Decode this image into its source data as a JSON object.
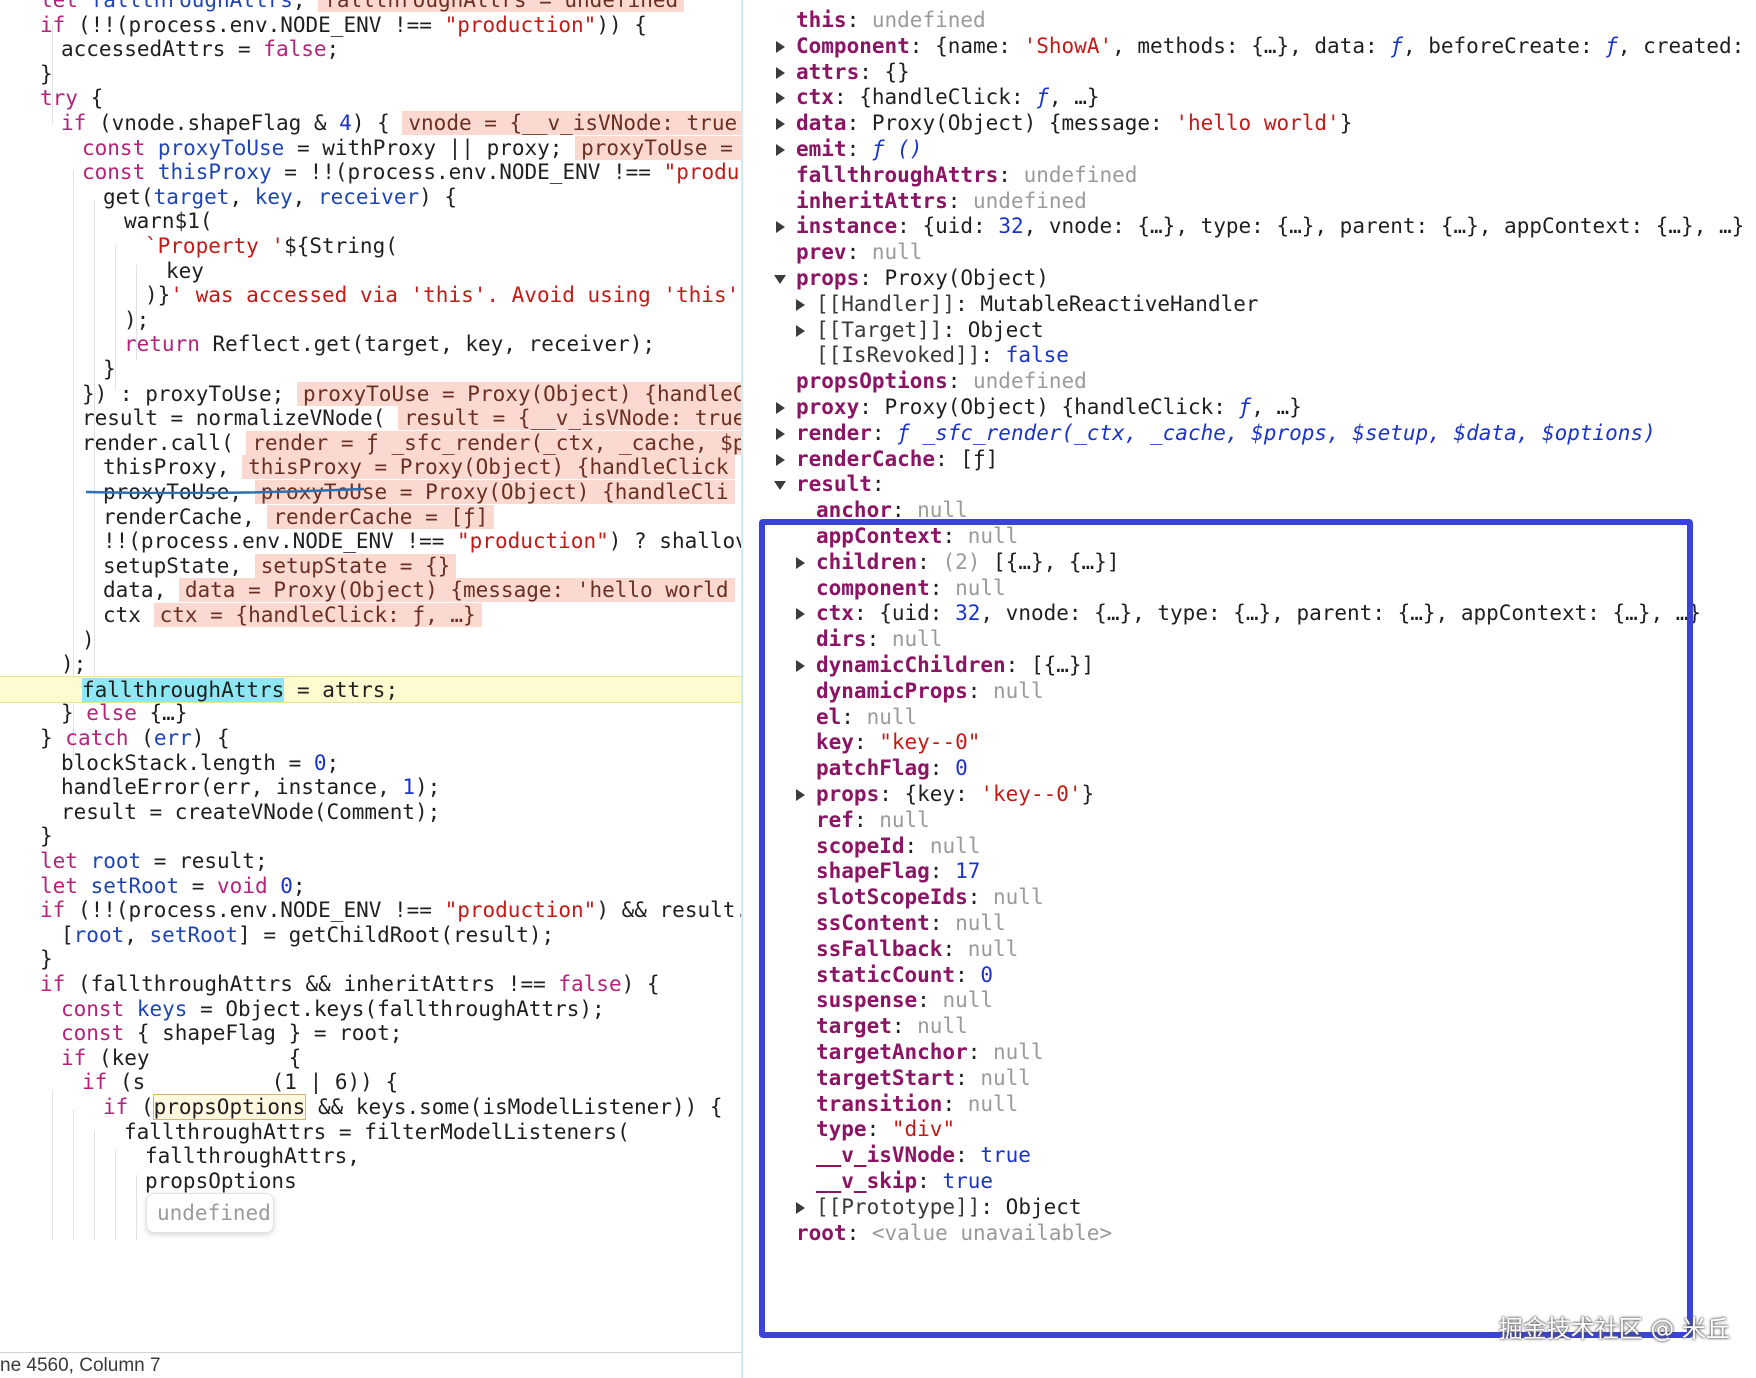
{
  "source": {
    "lines": [
      [
        [
          "kw",
          "let "
        ],
        [
          "id",
          "fallthroughAttrs"
        ],
        [
          "",
          "; "
        ],
        [
          "inl",
          "fallthroughAttrs = undefined"
        ]
      ],
      [
        [
          "kw",
          "if "
        ],
        [
          "",
          "(!!(process.env.NODE_ENV !== "
        ],
        [
          "str",
          "\"production\""
        ],
        [
          "",
          "))"
        ],
        [
          "",
          " {"
        ]
      ],
      [
        [
          "",
          "accessedAttrs = "
        ],
        [
          "kw",
          "false"
        ],
        [
          "",
          ";"
        ]
      ],
      [
        [
          "",
          "}"
        ]
      ],
      [
        [
          "kw",
          "try "
        ],
        [
          "",
          "{"
        ]
      ],
      [
        [
          "kw",
          "if "
        ],
        [
          "",
          "(vnode.shapeFlag & "
        ],
        [
          "num",
          "4"
        ],
        [
          "",
          ") { "
        ],
        [
          "inl",
          "vnode = {__v_isVNode: true, …"
        ]
      ],
      [
        [
          "kw",
          "const "
        ],
        [
          "id",
          "proxyToUse"
        ],
        [
          "",
          " = withProxy || proxy; "
        ],
        [
          "inl",
          "proxyToUse = P"
        ]
      ],
      [
        [
          "kw",
          "const "
        ],
        [
          "id",
          "thisProxy"
        ],
        [
          "",
          " = !!(process.env.NODE_ENV !== "
        ],
        [
          "str",
          "\"producti"
        ]
      ],
      [
        [
          "",
          "get("
        ],
        [
          "id",
          "target"
        ],
        [
          "",
          ", "
        ],
        [
          "id",
          "key"
        ],
        [
          "",
          ", "
        ],
        [
          "id",
          "receiver"
        ],
        [
          "",
          ") {"
        ]
      ],
      [
        [
          "",
          "warn$1("
        ]
      ],
      [
        [
          "str",
          "`Property '"
        ],
        [
          "",
          "${String("
        ]
      ],
      [
        [
          "",
          "key"
        ]
      ],
      [
        [
          "",
          ")}"
        ],
        [
          "str",
          "' was accessed via 'this'. Avoid using 'this' i"
        ]
      ],
      [
        [
          "",
          ");"
        ]
      ],
      [
        [
          "kw",
          "return "
        ],
        [
          "",
          "Reflect.get(target, key, receiver);"
        ]
      ],
      [
        [
          "",
          "}"
        ]
      ],
      [
        [
          "",
          "}) : proxyToUse; "
        ],
        [
          "inl",
          "proxyToUse = Proxy(Object) {handleCl"
        ]
      ],
      [
        [
          "",
          "result = normalizeVNode( "
        ],
        [
          "inl",
          "result = {__v_isVNode: true, "
        ]
      ],
      [
        [
          "",
          "render.call( "
        ],
        [
          "inl",
          "render = ƒ _sfc_render(_ctx, _cache, $p"
        ]
      ],
      [
        [
          "",
          "thisProxy, "
        ],
        [
          "inl",
          "thisProxy = Proxy(Object) {handleClick"
        ]
      ],
      [
        [
          "",
          "proxyToUse, "
        ],
        [
          "inl",
          "proxyToUse = Proxy(Object) {handleCli"
        ]
      ],
      [
        [
          "",
          "renderCache, "
        ],
        [
          "inl",
          "renderCache = [ƒ]"
        ]
      ],
      [
        [
          "",
          "!!(process.env.NODE_ENV !== "
        ],
        [
          "str",
          "\"production\""
        ],
        [
          "",
          ") ? shallov"
        ]
      ],
      [
        [
          "",
          "setupState, "
        ],
        [
          "inl",
          "setupState = {}"
        ]
      ],
      [
        [
          "",
          "data, "
        ],
        [
          "inl",
          "data = Proxy(Object) {message: 'hello world"
        ]
      ],
      [
        [
          "",
          "ctx "
        ],
        [
          "inl",
          "ctx = {handleClick: ƒ, …}"
        ]
      ],
      [
        [
          "",
          ")"
        ]
      ],
      [
        [
          "",
          ");"
        ]
      ],
      [
        [
          "hlw",
          "fallthroughAttrs"
        ],
        [
          "",
          " = attrs;"
        ]
      ],
      [
        [
          "",
          "} "
        ],
        [
          "kw",
          "else "
        ],
        [
          "",
          "{…}"
        ]
      ],
      [
        [
          "",
          "} "
        ],
        [
          "kw",
          "catch "
        ],
        [
          "",
          "("
        ],
        [
          "id",
          "err"
        ],
        [
          "",
          ") {"
        ]
      ],
      [
        [
          "",
          "blockStack.length = "
        ],
        [
          "num",
          "0"
        ],
        [
          "",
          ";"
        ]
      ],
      [
        [
          "",
          "handleError(err, instance, "
        ],
        [
          "num",
          "1"
        ],
        [
          "",
          ");"
        ]
      ],
      [
        [
          "",
          "result = createVNode(Comment);"
        ]
      ],
      [
        [
          "",
          "}"
        ]
      ],
      [
        [
          "kw",
          "let "
        ],
        [
          "id",
          "root"
        ],
        [
          "",
          " = result;"
        ]
      ],
      [
        [
          "kw",
          "let "
        ],
        [
          "id",
          "setRoot"
        ],
        [
          "",
          " = "
        ],
        [
          "kw",
          "void "
        ],
        [
          "num",
          "0"
        ],
        [
          "",
          ";"
        ]
      ],
      [
        [
          "kw",
          "if "
        ],
        [
          "",
          "(!!(process.env.NODE_ENV !== "
        ],
        [
          "str",
          "\"production\""
        ],
        [
          "",
          ") && result.pat"
        ]
      ],
      [
        [
          "",
          "["
        ],
        [
          "id",
          "root"
        ],
        [
          "",
          ", "
        ],
        [
          "id",
          "setRoot"
        ],
        [
          "",
          "] = getChildRoot(result);"
        ]
      ],
      [
        [
          "",
          "}"
        ]
      ],
      [
        [
          "kw",
          "if "
        ],
        [
          "",
          "(fallthroughAttrs && inheritAttrs !== "
        ],
        [
          "kw",
          "false"
        ],
        [
          "",
          ") {"
        ]
      ],
      [
        [
          "kw",
          "const "
        ],
        [
          "id",
          "keys"
        ],
        [
          "",
          " = Object.keys(fallthroughAttrs);"
        ]
      ],
      [
        [
          "kw",
          "const "
        ],
        [
          "",
          "{ shapeFlag } = root;"
        ]
      ],
      [
        [
          "kw",
          "if "
        ],
        [
          "",
          "(key"
        ],
        [
          "",
          "           {"
        ]
      ],
      [
        [
          "kw",
          "if "
        ],
        [
          "",
          "(s"
        ],
        [
          "",
          "          (1 | 6)) {"
        ]
      ],
      [
        [
          "kw",
          "if "
        ],
        [
          "",
          "("
        ],
        [
          "box",
          "propsOptions"
        ],
        [
          "",
          " && keys.some(isModelListener)) {"
        ]
      ],
      [
        [
          "",
          "fallthroughAttrs = filterModelListeners("
        ]
      ],
      [
        [
          "",
          "fallthroughAttrs,"
        ]
      ],
      [
        [
          "",
          "propsOptions"
        ]
      ]
    ],
    "status": "ne 4560, Column 7",
    "tooltip": "undefined"
  },
  "scope": {
    "rows": [
      {
        "tw": "none",
        "k": "this",
        "v": [
          [
            "nil",
            "undefined"
          ]
        ]
      },
      {
        "tw": "c",
        "k": "Component",
        "v": [
          [
            "vpl",
            "{name: "
          ],
          [
            "vstr",
            "'ShowA'"
          ],
          [
            "vpl",
            ", methods: {…}, data: "
          ],
          [
            "vfn",
            "ƒ"
          ],
          [
            "vpl",
            ", beforeCreate: "
          ],
          [
            "vfn",
            "ƒ"
          ],
          [
            "vpl",
            ", created: "
          ],
          [
            "vfn",
            "ƒ"
          ],
          [
            "vpl",
            ", …"
          ]
        ]
      },
      {
        "tw": "c",
        "k": "attrs",
        "v": [
          [
            "vpl",
            "{}"
          ]
        ]
      },
      {
        "tw": "c",
        "k": "ctx",
        "v": [
          [
            "vpl",
            "{handleClick: "
          ],
          [
            "vfn",
            "ƒ"
          ],
          [
            "vpl",
            ", …}"
          ]
        ]
      },
      {
        "tw": "c",
        "k": "data",
        "v": [
          [
            "vpl",
            "Proxy(Object) {message: "
          ],
          [
            "vstr",
            "'hello world'"
          ],
          [
            "vpl",
            "}"
          ]
        ]
      },
      {
        "tw": "c",
        "k": "emit",
        "v": [
          [
            "vfn",
            "ƒ ()"
          ]
        ]
      },
      {
        "tw": "none",
        "k": "fallthroughAttrs",
        "v": [
          [
            "nil",
            "undefined"
          ]
        ]
      },
      {
        "tw": "none",
        "k": "inheritAttrs",
        "v": [
          [
            "nil",
            "undefined"
          ]
        ]
      },
      {
        "tw": "c",
        "k": "instance",
        "v": [
          [
            "vpl",
            "{uid: "
          ],
          [
            "vnum",
            "32"
          ],
          [
            "vpl",
            ", vnode: {…}, type: {…}, parent: {…}, appContext: {…}, …}"
          ]
        ]
      },
      {
        "tw": "none",
        "k": "prev",
        "v": [
          [
            "nil",
            "null"
          ]
        ]
      },
      {
        "tw": "e",
        "k": "props",
        "v": [
          [
            "vpl",
            "Proxy(Object)"
          ]
        ]
      },
      {
        "tw": "c",
        "indent": 1,
        "inner": true,
        "k": "[[Handler]]",
        "v": [
          [
            "vpl",
            "MutableReactiveHandler"
          ]
        ]
      },
      {
        "tw": "c",
        "indent": 1,
        "inner": true,
        "k": "[[Target]]",
        "v": [
          [
            "vpl",
            "Object"
          ]
        ]
      },
      {
        "tw": "none",
        "indent": 1,
        "inner": true,
        "k": "[[IsRevoked]]",
        "v": [
          [
            "vbool",
            "false"
          ]
        ]
      },
      {
        "tw": "none",
        "k": "propsOptions",
        "v": [
          [
            "nil",
            "undefined"
          ]
        ]
      },
      {
        "tw": "c",
        "k": "proxy",
        "v": [
          [
            "vpl",
            "Proxy(Object) {handleClick: "
          ],
          [
            "vfn",
            "ƒ"
          ],
          [
            "vpl",
            ", …}"
          ]
        ]
      },
      {
        "tw": "c",
        "k": "render",
        "v": [
          [
            "vfn",
            "ƒ _sfc_render(_ctx, _cache, $props, $setup, $data, $options)"
          ]
        ]
      },
      {
        "tw": "c",
        "k": "renderCache",
        "v": [
          [
            "vpl",
            "[ƒ]"
          ]
        ]
      },
      {
        "tw": "e",
        "k": "result",
        "v": []
      },
      {
        "tw": "none",
        "indent": 1,
        "k": "anchor",
        "v": [
          [
            "nil",
            "null"
          ]
        ]
      },
      {
        "tw": "none",
        "indent": 1,
        "k": "appContext",
        "v": [
          [
            "nil",
            "null"
          ]
        ]
      },
      {
        "tw": "c",
        "indent": 1,
        "k": "children",
        "v": [
          [
            "nil",
            "(2) "
          ],
          [
            "vpl",
            "[{…}, {…}]"
          ]
        ]
      },
      {
        "tw": "none",
        "indent": 1,
        "k": "component",
        "v": [
          [
            "nil",
            "null"
          ]
        ]
      },
      {
        "tw": "c",
        "indent": 1,
        "k": "ctx",
        "v": [
          [
            "vpl",
            "{uid: "
          ],
          [
            "vnum",
            "32"
          ],
          [
            "vpl",
            ", vnode: {…}, type: {…}, parent: {…}, appContext: {…}, …}"
          ]
        ]
      },
      {
        "tw": "none",
        "indent": 1,
        "k": "dirs",
        "v": [
          [
            "nil",
            "null"
          ]
        ]
      },
      {
        "tw": "c",
        "indent": 1,
        "k": "dynamicChildren",
        "v": [
          [
            "vpl",
            "[{…}]"
          ]
        ]
      },
      {
        "tw": "none",
        "indent": 1,
        "k": "dynamicProps",
        "v": [
          [
            "nil",
            "null"
          ]
        ]
      },
      {
        "tw": "none",
        "indent": 1,
        "k": "el",
        "v": [
          [
            "nil",
            "null"
          ]
        ]
      },
      {
        "tw": "none",
        "indent": 1,
        "k": "key",
        "v": [
          [
            "vstr",
            "\"key--0\""
          ]
        ]
      },
      {
        "tw": "none",
        "indent": 1,
        "k": "patchFlag",
        "v": [
          [
            "vnum",
            "0"
          ]
        ]
      },
      {
        "tw": "c",
        "indent": 1,
        "k": "props",
        "v": [
          [
            "vpl",
            "{key: "
          ],
          [
            "vstr",
            "'key--0'"
          ],
          [
            "vpl",
            "}"
          ]
        ]
      },
      {
        "tw": "none",
        "indent": 1,
        "k": "ref",
        "v": [
          [
            "nil",
            "null"
          ]
        ]
      },
      {
        "tw": "none",
        "indent": 1,
        "k": "scopeId",
        "v": [
          [
            "nil",
            "null"
          ]
        ]
      },
      {
        "tw": "none",
        "indent": 1,
        "k": "shapeFlag",
        "v": [
          [
            "vnum",
            "17"
          ]
        ]
      },
      {
        "tw": "none",
        "indent": 1,
        "k": "slotScopeIds",
        "v": [
          [
            "nil",
            "null"
          ]
        ]
      },
      {
        "tw": "none",
        "indent": 1,
        "k": "ssContent",
        "v": [
          [
            "nil",
            "null"
          ]
        ]
      },
      {
        "tw": "none",
        "indent": 1,
        "k": "ssFallback",
        "v": [
          [
            "nil",
            "null"
          ]
        ]
      },
      {
        "tw": "none",
        "indent": 1,
        "k": "staticCount",
        "v": [
          [
            "vnum",
            "0"
          ]
        ]
      },
      {
        "tw": "none",
        "indent": 1,
        "k": "suspense",
        "v": [
          [
            "nil",
            "null"
          ]
        ]
      },
      {
        "tw": "none",
        "indent": 1,
        "k": "target",
        "v": [
          [
            "nil",
            "null"
          ]
        ]
      },
      {
        "tw": "none",
        "indent": 1,
        "k": "targetAnchor",
        "v": [
          [
            "nil",
            "null"
          ]
        ]
      },
      {
        "tw": "none",
        "indent": 1,
        "k": "targetStart",
        "v": [
          [
            "nil",
            "null"
          ]
        ]
      },
      {
        "tw": "none",
        "indent": 1,
        "k": "transition",
        "v": [
          [
            "nil",
            "null"
          ]
        ]
      },
      {
        "tw": "none",
        "indent": 1,
        "k": "type",
        "v": [
          [
            "vstr",
            "\"div\""
          ]
        ]
      },
      {
        "tw": "none",
        "indent": 1,
        "k": "__v_isVNode",
        "v": [
          [
            "vbool",
            "true"
          ]
        ]
      },
      {
        "tw": "none",
        "indent": 1,
        "k": "__v_skip",
        "v": [
          [
            "vbool",
            "true"
          ]
        ]
      },
      {
        "tw": "c",
        "indent": 1,
        "inner": true,
        "k": "[[Prototype]]",
        "v": [
          [
            "vpl",
            "Object"
          ]
        ]
      },
      {
        "tw": "none",
        "k": "root",
        "v": [
          [
            "nil",
            "<value unavailable>"
          ]
        ]
      }
    ]
  },
  "watermark": "掘金技术社区 @ 米丘",
  "colors": {
    "highlight_box": "#3a45d6",
    "current_line": "#fffbd0",
    "keyword": "#b4227b",
    "string": "#c41a16",
    "number": "#1a34c9",
    "inline_value": "#fcd9d0"
  }
}
